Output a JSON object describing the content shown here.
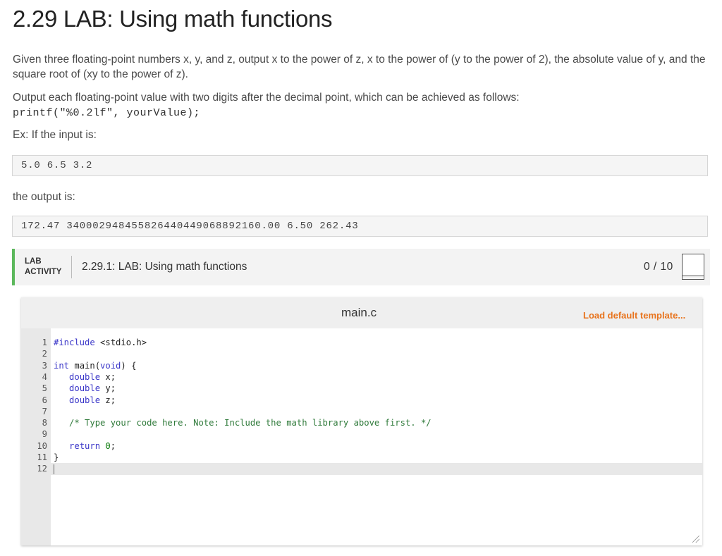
{
  "page": {
    "title": "2.29 LAB: Using math functions",
    "description_1": "Given three floating-point numbers x, y, and z, output x to the power of z, x to the power of (y to the power of 2), the absolute value of y, and the square root of (xy to the power of z).",
    "description_2": "Output each floating-point value with two digits after the decimal point, which can be achieved as follows:",
    "code_example": "printf(\"%0.2lf\", yourValue);",
    "example_label": "Ex: If the input is:",
    "example_input": "5.0 6.5 3.2",
    "output_label": "the output is:",
    "example_output": "172.47 340002948455826440449068892160.00 6.50 262.43"
  },
  "lab": {
    "tag_line1": "LAB",
    "tag_line2": "ACTIVITY",
    "title": "2.29.1: LAB: Using math functions",
    "score": "0 / 10",
    "accent_color": "#5cb85c"
  },
  "editor": {
    "file_name": "main.c",
    "load_default_label": "Load default template...",
    "load_default_color": "#e8731c",
    "lines": [
      {
        "n": "1",
        "code": "#include <stdio.h>"
      },
      {
        "n": "2",
        "code": ""
      },
      {
        "n": "3",
        "code": "int main(void) {"
      },
      {
        "n": "4",
        "code": "   double x;"
      },
      {
        "n": "5",
        "code": "   double y;"
      },
      {
        "n": "6",
        "code": "   double z;"
      },
      {
        "n": "7",
        "code": ""
      },
      {
        "n": "8",
        "code": "   /* Type your code here. Note: Include the math library above first. */"
      },
      {
        "n": "9",
        "code": ""
      },
      {
        "n": "10",
        "code": "   return 0;"
      },
      {
        "n": "11",
        "code": "}"
      },
      {
        "n": "12",
        "code": ""
      }
    ]
  }
}
